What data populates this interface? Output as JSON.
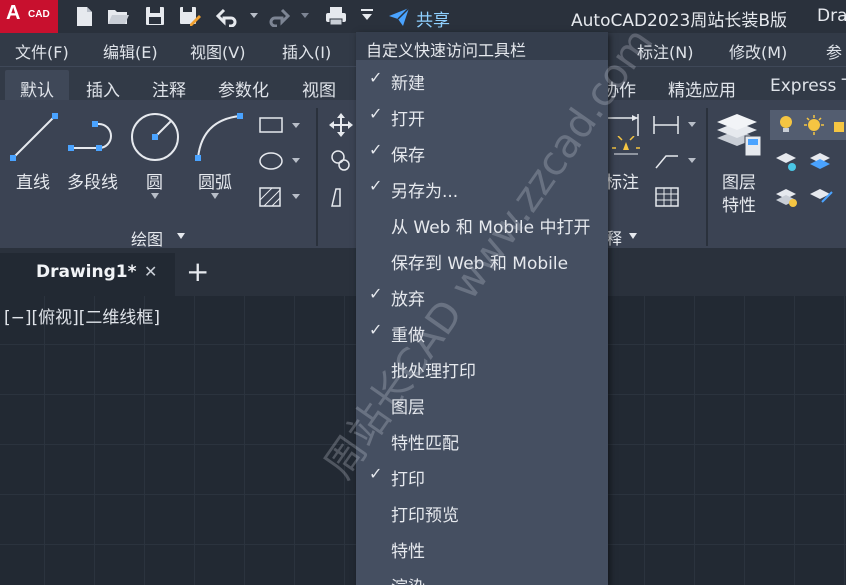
{
  "titlebar": {
    "logo_letter": "A",
    "logo_text": "CAD",
    "share_label": "共享",
    "app_title": "AutoCAD2023周站长装B版",
    "file_title": "Dra"
  },
  "menubar": {
    "items": [
      "文件(F)",
      "编辑(E)",
      "视图(V)",
      "插入(I)",
      "标注(N)",
      "修改(M)",
      "参"
    ]
  },
  "ribbon_tabs": {
    "items": [
      "默认",
      "插入",
      "注释",
      "参数化",
      "视图",
      "协作",
      "精选应用",
      "Express T"
    ]
  },
  "ribbon": {
    "draw_tools": [
      "直线",
      "多段线",
      "圆",
      "圆弧"
    ],
    "draw_panel_label": "绘图",
    "annotation_tool": "标注",
    "annotation_panel_fragment": "释",
    "layer_label_1": "图层",
    "layer_label_2": "特性"
  },
  "doc_tab": {
    "title": "Drawing1*",
    "close": "✕",
    "add": "+"
  },
  "viewport": {
    "label": "[−][俯视][二维线框]"
  },
  "dropdown": {
    "title": "自定义快速访问工具栏",
    "items": [
      {
        "label": "新建",
        "checked": "✓"
      },
      {
        "label": "打开",
        "checked": "✓"
      },
      {
        "label": "保存",
        "checked": "✓"
      },
      {
        "label": "另存为...",
        "checked": "✓"
      },
      {
        "label": "从 Web 和 Mobile 中打开",
        "checked": ""
      },
      {
        "label": "保存到 Web 和 Mobile",
        "checked": ""
      },
      {
        "label": "放弃",
        "checked": "✓"
      },
      {
        "label": "重做",
        "checked": "✓"
      },
      {
        "label": "批处理打印",
        "checked": ""
      },
      {
        "label": "图层",
        "checked": ""
      },
      {
        "label": "特性匹配",
        "checked": ""
      },
      {
        "label": "打印",
        "checked": "✓"
      },
      {
        "label": "打印预览",
        "checked": ""
      },
      {
        "label": "特性",
        "checked": ""
      },
      {
        "label": "渲染",
        "checked": ""
      }
    ]
  },
  "watermark": "周站长CAD www.zzcad.com",
  "colors": {
    "logo_red": "#c8102e",
    "share_blue": "#8fd0ff",
    "accent_blue": "#4aa3ff"
  }
}
